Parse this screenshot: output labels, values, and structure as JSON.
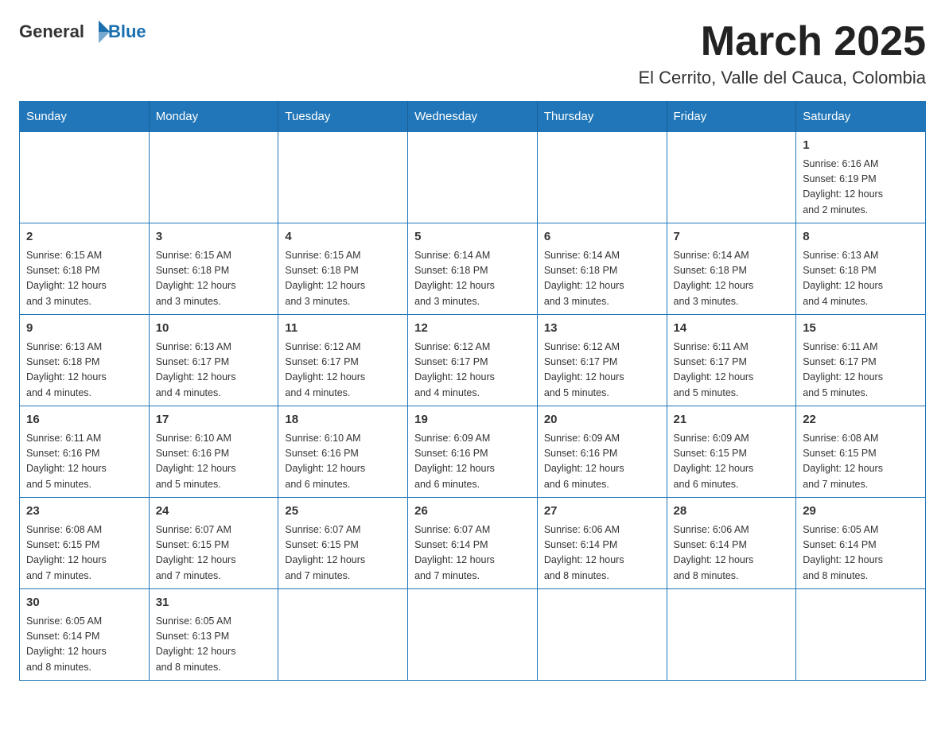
{
  "logo": {
    "general": "General",
    "blue": "Blue"
  },
  "header": {
    "month": "March 2025",
    "location": "El Cerrito, Valle del Cauca, Colombia"
  },
  "weekdays": [
    "Sunday",
    "Monday",
    "Tuesday",
    "Wednesday",
    "Thursday",
    "Friday",
    "Saturday"
  ],
  "weeks": [
    [
      {
        "day": "",
        "info": ""
      },
      {
        "day": "",
        "info": ""
      },
      {
        "day": "",
        "info": ""
      },
      {
        "day": "",
        "info": ""
      },
      {
        "day": "",
        "info": ""
      },
      {
        "day": "",
        "info": ""
      },
      {
        "day": "1",
        "info": "Sunrise: 6:16 AM\nSunset: 6:19 PM\nDaylight: 12 hours\nand 2 minutes."
      }
    ],
    [
      {
        "day": "2",
        "info": "Sunrise: 6:15 AM\nSunset: 6:18 PM\nDaylight: 12 hours\nand 3 minutes."
      },
      {
        "day": "3",
        "info": "Sunrise: 6:15 AM\nSunset: 6:18 PM\nDaylight: 12 hours\nand 3 minutes."
      },
      {
        "day": "4",
        "info": "Sunrise: 6:15 AM\nSunset: 6:18 PM\nDaylight: 12 hours\nand 3 minutes."
      },
      {
        "day": "5",
        "info": "Sunrise: 6:14 AM\nSunset: 6:18 PM\nDaylight: 12 hours\nand 3 minutes."
      },
      {
        "day": "6",
        "info": "Sunrise: 6:14 AM\nSunset: 6:18 PM\nDaylight: 12 hours\nand 3 minutes."
      },
      {
        "day": "7",
        "info": "Sunrise: 6:14 AM\nSunset: 6:18 PM\nDaylight: 12 hours\nand 3 minutes."
      },
      {
        "day": "8",
        "info": "Sunrise: 6:13 AM\nSunset: 6:18 PM\nDaylight: 12 hours\nand 4 minutes."
      }
    ],
    [
      {
        "day": "9",
        "info": "Sunrise: 6:13 AM\nSunset: 6:18 PM\nDaylight: 12 hours\nand 4 minutes."
      },
      {
        "day": "10",
        "info": "Sunrise: 6:13 AM\nSunset: 6:17 PM\nDaylight: 12 hours\nand 4 minutes."
      },
      {
        "day": "11",
        "info": "Sunrise: 6:12 AM\nSunset: 6:17 PM\nDaylight: 12 hours\nand 4 minutes."
      },
      {
        "day": "12",
        "info": "Sunrise: 6:12 AM\nSunset: 6:17 PM\nDaylight: 12 hours\nand 4 minutes."
      },
      {
        "day": "13",
        "info": "Sunrise: 6:12 AM\nSunset: 6:17 PM\nDaylight: 12 hours\nand 5 minutes."
      },
      {
        "day": "14",
        "info": "Sunrise: 6:11 AM\nSunset: 6:17 PM\nDaylight: 12 hours\nand 5 minutes."
      },
      {
        "day": "15",
        "info": "Sunrise: 6:11 AM\nSunset: 6:17 PM\nDaylight: 12 hours\nand 5 minutes."
      }
    ],
    [
      {
        "day": "16",
        "info": "Sunrise: 6:11 AM\nSunset: 6:16 PM\nDaylight: 12 hours\nand 5 minutes."
      },
      {
        "day": "17",
        "info": "Sunrise: 6:10 AM\nSunset: 6:16 PM\nDaylight: 12 hours\nand 5 minutes."
      },
      {
        "day": "18",
        "info": "Sunrise: 6:10 AM\nSunset: 6:16 PM\nDaylight: 12 hours\nand 6 minutes."
      },
      {
        "day": "19",
        "info": "Sunrise: 6:09 AM\nSunset: 6:16 PM\nDaylight: 12 hours\nand 6 minutes."
      },
      {
        "day": "20",
        "info": "Sunrise: 6:09 AM\nSunset: 6:16 PM\nDaylight: 12 hours\nand 6 minutes."
      },
      {
        "day": "21",
        "info": "Sunrise: 6:09 AM\nSunset: 6:15 PM\nDaylight: 12 hours\nand 6 minutes."
      },
      {
        "day": "22",
        "info": "Sunrise: 6:08 AM\nSunset: 6:15 PM\nDaylight: 12 hours\nand 7 minutes."
      }
    ],
    [
      {
        "day": "23",
        "info": "Sunrise: 6:08 AM\nSunset: 6:15 PM\nDaylight: 12 hours\nand 7 minutes."
      },
      {
        "day": "24",
        "info": "Sunrise: 6:07 AM\nSunset: 6:15 PM\nDaylight: 12 hours\nand 7 minutes."
      },
      {
        "day": "25",
        "info": "Sunrise: 6:07 AM\nSunset: 6:15 PM\nDaylight: 12 hours\nand 7 minutes."
      },
      {
        "day": "26",
        "info": "Sunrise: 6:07 AM\nSunset: 6:14 PM\nDaylight: 12 hours\nand 7 minutes."
      },
      {
        "day": "27",
        "info": "Sunrise: 6:06 AM\nSunset: 6:14 PM\nDaylight: 12 hours\nand 8 minutes."
      },
      {
        "day": "28",
        "info": "Sunrise: 6:06 AM\nSunset: 6:14 PM\nDaylight: 12 hours\nand 8 minutes."
      },
      {
        "day": "29",
        "info": "Sunrise: 6:05 AM\nSunset: 6:14 PM\nDaylight: 12 hours\nand 8 minutes."
      }
    ],
    [
      {
        "day": "30",
        "info": "Sunrise: 6:05 AM\nSunset: 6:14 PM\nDaylight: 12 hours\nand 8 minutes."
      },
      {
        "day": "31",
        "info": "Sunrise: 6:05 AM\nSunset: 6:13 PM\nDaylight: 12 hours\nand 8 minutes."
      },
      {
        "day": "",
        "info": ""
      },
      {
        "day": "",
        "info": ""
      },
      {
        "day": "",
        "info": ""
      },
      {
        "day": "",
        "info": ""
      },
      {
        "day": "",
        "info": ""
      }
    ]
  ]
}
